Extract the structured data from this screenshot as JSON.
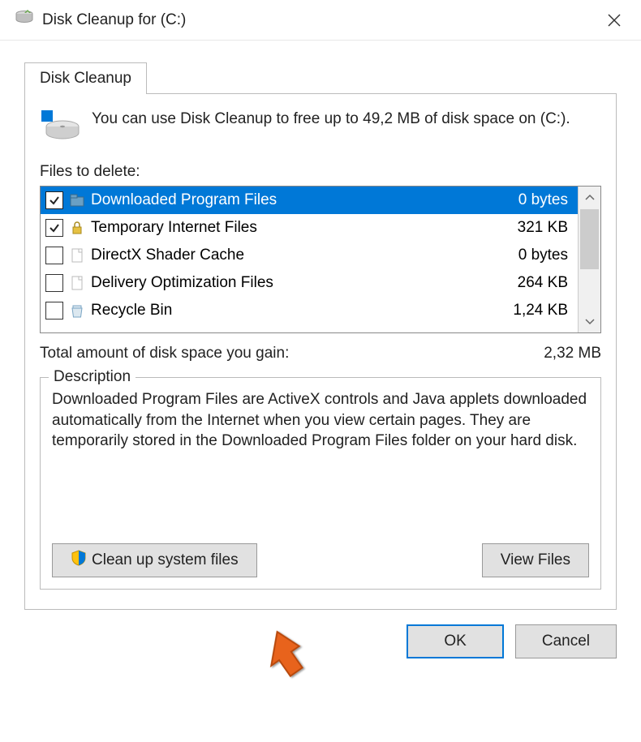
{
  "window": {
    "title": "Disk Cleanup for  (C:)"
  },
  "tab": {
    "label": "Disk Cleanup"
  },
  "summary": {
    "text": "You can use Disk Cleanup to free up to 49,2 MB of disk space on  (C:)."
  },
  "files_label": "Files to delete:",
  "items": [
    {
      "checked": true,
      "icon": "folder",
      "name": "Downloaded Program Files",
      "size": "0 bytes",
      "selected": true
    },
    {
      "checked": true,
      "icon": "lock",
      "name": "Temporary Internet Files",
      "size": "321 KB",
      "selected": false
    },
    {
      "checked": false,
      "icon": "file",
      "name": "DirectX Shader Cache",
      "size": "0 bytes",
      "selected": false
    },
    {
      "checked": false,
      "icon": "file",
      "name": "Delivery Optimization Files",
      "size": "264 KB",
      "selected": false
    },
    {
      "checked": false,
      "icon": "recycle",
      "name": "Recycle Bin",
      "size": "1,24 KB",
      "selected": false
    }
  ],
  "total": {
    "label": "Total amount of disk space you gain:",
    "value": "2,32 MB"
  },
  "description": {
    "legend": "Description",
    "text": "Downloaded Program Files are ActiveX controls and Java applets downloaded automatically from the Internet when you view certain pages. They are temporarily stored in the Downloaded Program Files folder on your hard disk."
  },
  "buttons": {
    "cleanup": "Clean up system files",
    "view": "View Files",
    "ok": "OK",
    "cancel": "Cancel"
  }
}
